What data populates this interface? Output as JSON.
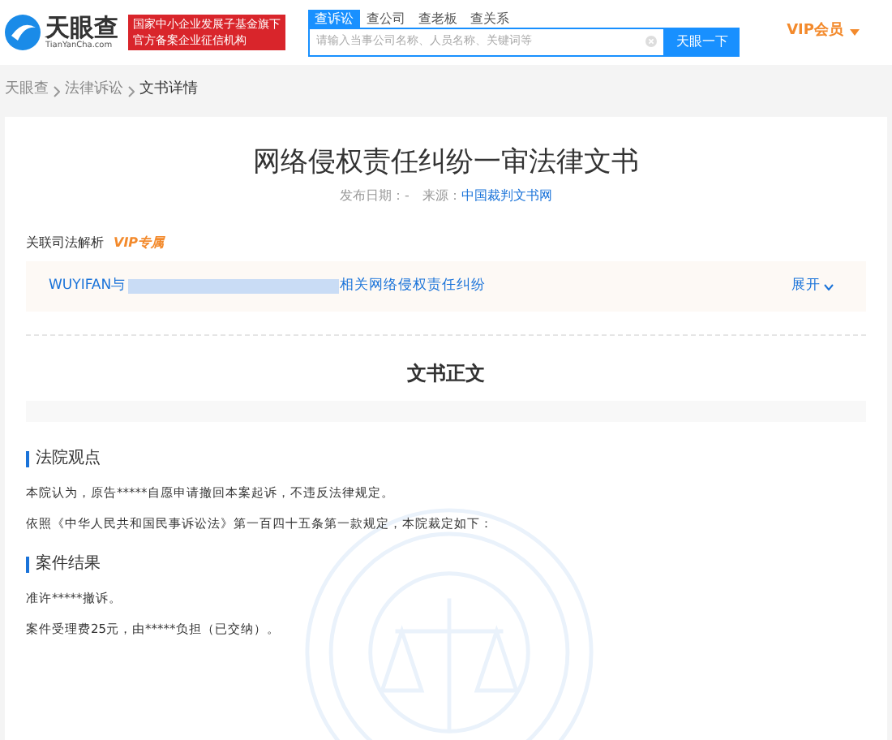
{
  "header": {
    "logo": {
      "name": "天眼查",
      "domain": "TianYanCha.com"
    },
    "banner": [
      "国家中小企业发展子基金旗下",
      "官方备案企业征信机构"
    ],
    "search_tabs": [
      {
        "label": "查诉讼",
        "selected": true
      },
      {
        "label": "查公司",
        "selected": false
      },
      {
        "label": "查老板",
        "selected": false
      },
      {
        "label": "查关系",
        "selected": false
      }
    ],
    "search": {
      "placeholder": "请输入当事公司名称、人员名称、关键词等",
      "button": "天眼一下"
    },
    "vip": "VIP会员"
  },
  "breadcrumb": [
    "天眼查",
    "法律诉讼",
    "文书详情"
  ],
  "document": {
    "title": "网络侵权责任纠纷一审法律文书",
    "date_label": "发布日期：-",
    "source_label": "来源：",
    "source": "中国裁判文书网",
    "related": {
      "label": "关联司法解析",
      "badge": "VIP专属",
      "link_start": "WUYIFAN与",
      "link_end": "相关网络侵权责任纠纷",
      "expand": "展开"
    },
    "body_title": "文书正文",
    "sections": [
      {
        "heading": "法院观点",
        "paragraphs": [
          "本院认为，原告*****自愿申请撤回本案起诉，不违反法律规定。",
          "依照《中华人民共和国民事诉讼法》第一百四十五条第一款规定，本院裁定如下："
        ]
      },
      {
        "heading": "案件结果",
        "paragraphs": [
          "准许*****撤诉。",
          "案件受理费25元，由*****负担（已交纳）。"
        ]
      }
    ]
  }
}
